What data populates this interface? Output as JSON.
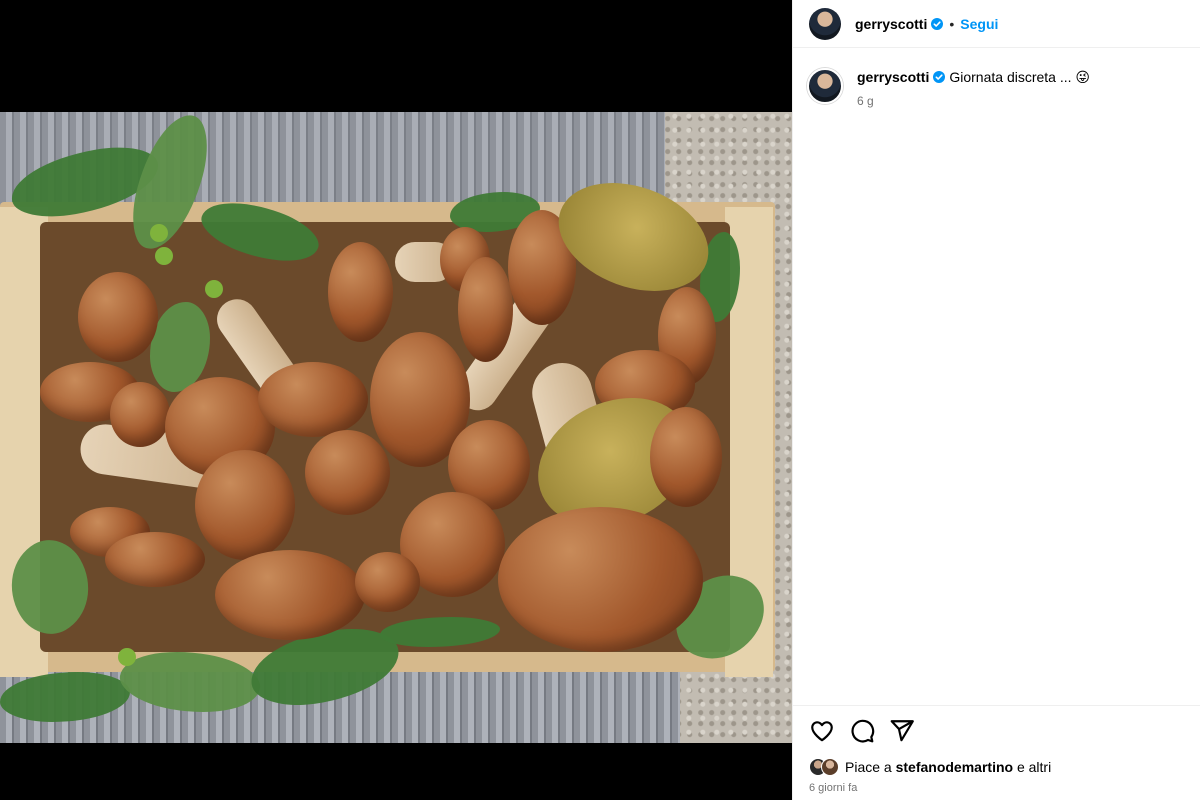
{
  "post": {
    "username": "gerryscotti",
    "separator": "•",
    "follow_label": "Segui",
    "caption": "Giornata discreta ...",
    "caption_emoji": "😜",
    "caption_age": "6 g",
    "likes_prefix": "Piace a ",
    "likes_user": "stefanodemartino",
    "likes_suffix": " e altri",
    "date": "6 giorni fa"
  },
  "icons": {
    "verified": "verified-badge-icon",
    "like": "heart-icon",
    "comment": "comment-icon",
    "share": "paper-plane-icon"
  },
  "colors": {
    "accent": "#0095f6",
    "secondary_text": "#737373",
    "verified": "#0095f6"
  }
}
